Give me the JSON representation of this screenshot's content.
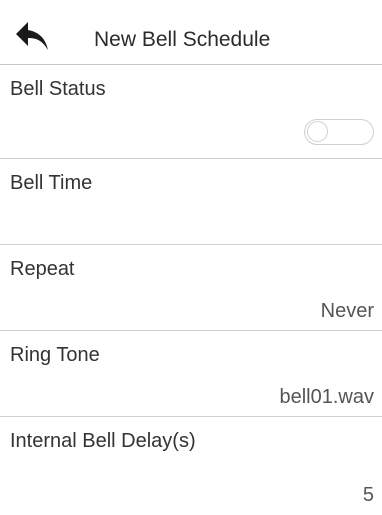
{
  "header": {
    "title": "New Bell Schedule",
    "back_icon": "back-arrow-icon"
  },
  "rows": [
    {
      "label": "Bell Status",
      "value": "",
      "toggle_on": false
    },
    {
      "label": "Bell Time",
      "value": ""
    },
    {
      "label": "Repeat",
      "value": "Never"
    },
    {
      "label": "Ring Tone",
      "value": "bell01.wav"
    },
    {
      "label": "Internal Bell Delay(s)",
      "value": "5"
    }
  ],
  "colors": {
    "background": "#ffffff",
    "text": "#333333",
    "divider": "#cfcfcf",
    "toggle_border": "#d0d0d0"
  }
}
